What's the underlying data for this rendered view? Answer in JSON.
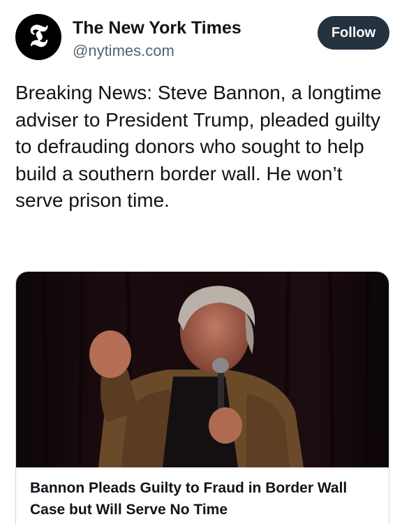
{
  "account": {
    "display_name": "The New York Times",
    "handle": "@nytimes.com",
    "avatar_glyph": "𝕿",
    "avatar_icon": "nyt-logo-icon"
  },
  "actions": {
    "follow_label": "Follow"
  },
  "tweet": {
    "text": "Breaking News: Steve Bannon, a longtime adviser to President Trump, pleaded guilty to defrauding donors who sought to help build a southern border wall. He won’t serve prison time."
  },
  "link_card": {
    "title": "Bannon Pleads Guilty to Fraud in Border Wall Case but Will Serve No Time"
  },
  "colors": {
    "follow_button_bg": "#25323f",
    "text_primary": "#0f1419",
    "text_secondary": "#536471"
  }
}
